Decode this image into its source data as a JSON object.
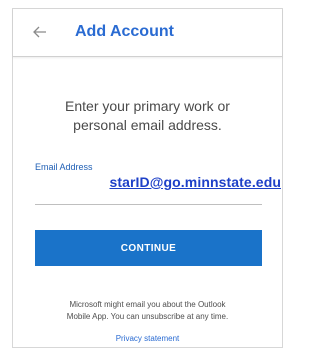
{
  "header": {
    "back_icon": "arrow-left-icon",
    "title": "Add Account"
  },
  "prompt": {
    "line1": "Enter your primary work or",
    "line2": "personal email address."
  },
  "email": {
    "label": "Email Address",
    "value": "starID@go.minnstate.edu"
  },
  "continue_label": "CONTINUE",
  "notice": {
    "line1": "Microsoft might email you about the Outlook",
    "line2": "Mobile App. You can unsubscribe at any time."
  },
  "privacy_link": "Privacy statement",
  "colors": {
    "accent": "#2a6bd2",
    "button": "#1a73c9",
    "email_overlay": "#1e40c8"
  }
}
